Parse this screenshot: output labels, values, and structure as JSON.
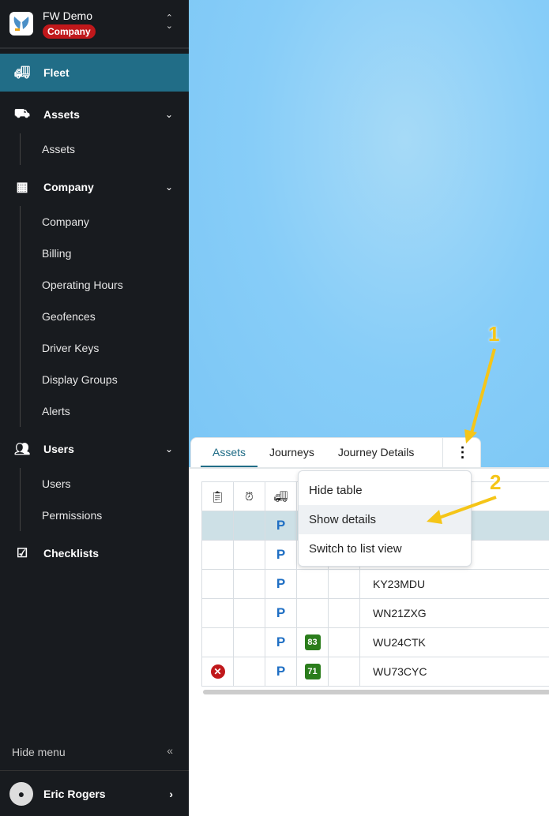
{
  "org": {
    "name": "FW Demo",
    "badge": "Company"
  },
  "nav": {
    "fleet": "Fleet",
    "assets": "Assets",
    "assets_sub": [
      "Assets"
    ],
    "company": "Company",
    "company_sub": [
      "Company",
      "Billing",
      "Operating Hours",
      "Geofences",
      "Driver Keys",
      "Display Groups",
      "Alerts"
    ],
    "users": "Users",
    "users_sub": [
      "Users",
      "Permissions"
    ],
    "checklists": "Checklists",
    "hide_menu": "Hide menu",
    "user_name": "Eric Rogers"
  },
  "tabs": [
    "Assets",
    "Journeys",
    "Journey Details"
  ],
  "menu": [
    "Hide table",
    "Show details",
    "Switch to list view"
  ],
  "rows": [
    {
      "status": "",
      "park": "P",
      "num": "",
      "reg": ""
    },
    {
      "status": "",
      "park": "P",
      "num": "",
      "reg": ""
    },
    {
      "status": "",
      "park": "P",
      "num": "",
      "reg": "KY23MDU"
    },
    {
      "status": "",
      "park": "P",
      "num": "",
      "reg": "WN21ZXG"
    },
    {
      "status": "",
      "park": "P",
      "num": "83",
      "reg": "WU24CTK"
    },
    {
      "status": "error",
      "park": "P",
      "num": "71",
      "reg": "WU73CYC"
    }
  ],
  "annotations": [
    "1",
    "2"
  ],
  "colors": {
    "accent": "#216d87",
    "badge": "#c0181b",
    "annotation": "#f5c518"
  }
}
